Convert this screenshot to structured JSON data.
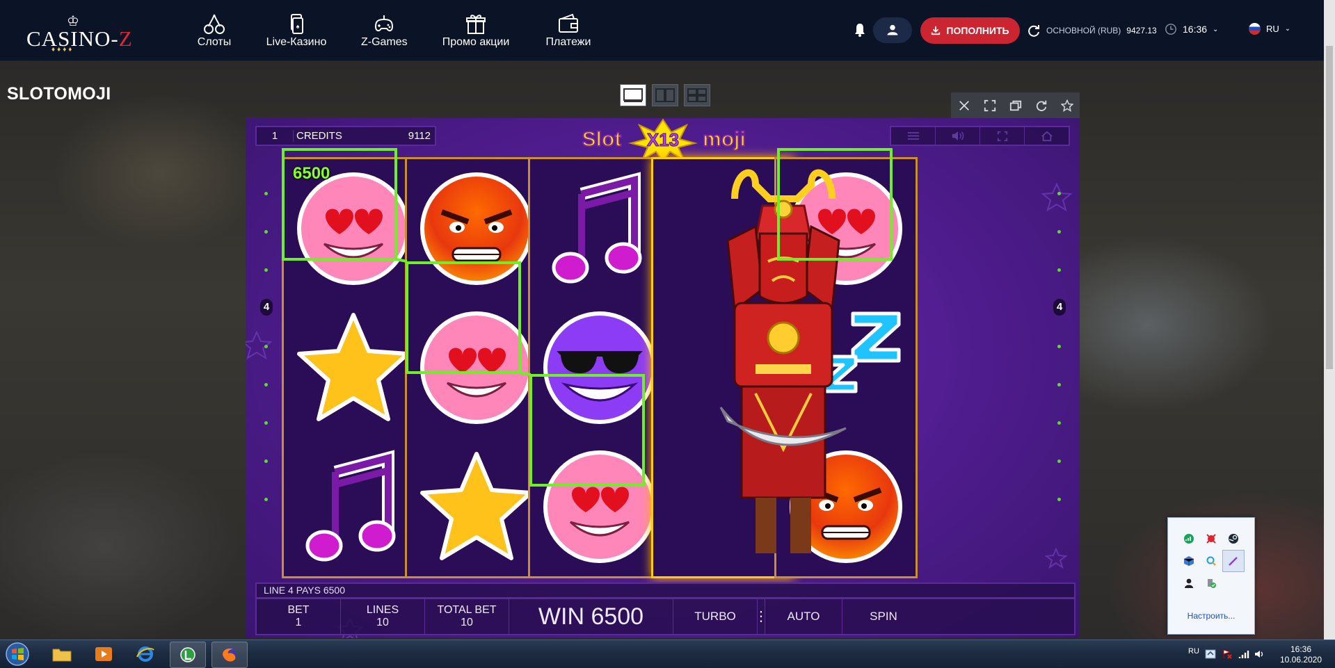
{
  "header": {
    "logo_text_a": "CASINO",
    "logo_text_b": "Z",
    "nav": [
      {
        "label": "Слоты",
        "icon": "cherry-icon"
      },
      {
        "label": "Live-Казино",
        "icon": "cards-icon"
      },
      {
        "label": "Z-Games",
        "icon": "gamepad-icon"
      },
      {
        "label": "Промо акции",
        "icon": "gift-icon"
      },
      {
        "label": "Платежи",
        "icon": "wallet-icon"
      }
    ],
    "deposit_label": "ПОПОЛНИТЬ",
    "balance_label": "ОСНОВНОЙ (RUB)",
    "balance_amount": "9427.13",
    "time": "16:36",
    "language": "RU"
  },
  "page": {
    "title": "SLOTOMOJI"
  },
  "game": {
    "logo_left": "Slot",
    "logo_mid": "X13",
    "logo_right": "moji",
    "credits_line": "1",
    "credits_label": "CREDITS",
    "credits_value": "9112",
    "win_amount_label": "6500",
    "line_number": "4",
    "pays_text": "LINE 4 PAYS 6500",
    "bet_label": "BET",
    "bet_value": "1",
    "lines_label": "LINES",
    "lines_value": "10",
    "total_bet_label": "TOTAL BET",
    "total_bet_value": "10",
    "win_text": "WIN 6500",
    "turbo_label": "TURBO",
    "auto_label": "AUTO",
    "spin_label": "SPIN",
    "reels": [
      [
        "love-emoji",
        "star",
        "music-note"
      ],
      [
        "angry-emoji",
        "love-emoji",
        "star"
      ],
      [
        "music-note",
        "cool-emoji",
        "love-emoji"
      ],
      [
        "samurai",
        "samurai",
        "samurai"
      ],
      [
        "love-emoji",
        "sleep-zzz",
        "angry-emoji"
      ]
    ]
  },
  "tray_popup": {
    "customize_link": "Настроить..."
  },
  "taskbar": {
    "lang": "RU",
    "time": "16:36",
    "date": "10.06.2020"
  },
  "colors": {
    "header_bg": "#0b1426",
    "deposit_red": "#cc2532",
    "game_purple": "#4e1c8c",
    "win_green": "#6ef026",
    "reel_gold": "#c9902b"
  }
}
